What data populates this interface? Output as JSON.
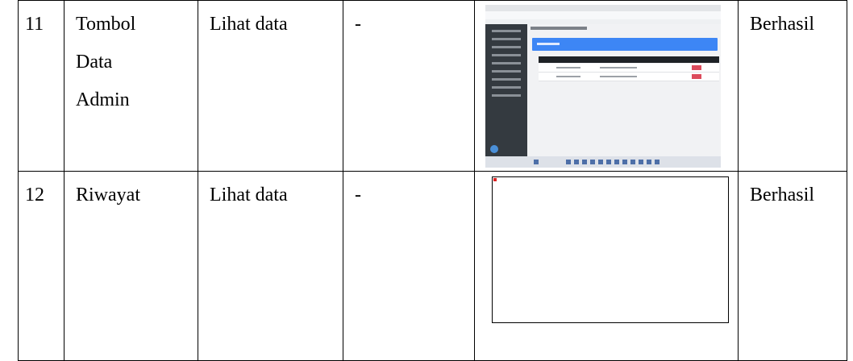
{
  "rows": [
    {
      "no": "11",
      "name_lines": [
        "Tombol",
        "Data",
        "Admin"
      ],
      "action": "Lihat data",
      "input": "-",
      "result": "Berhasil"
    },
    {
      "no": "12",
      "name_lines": [
        "Riwayat"
      ],
      "action": "Lihat data",
      "input": "-",
      "result": "Berhasil"
    }
  ],
  "colors": {
    "border": "#000000",
    "admin_sidebar": "#343a40",
    "admin_button": "#3d86f5",
    "delete_button": "#dc4b5c"
  }
}
